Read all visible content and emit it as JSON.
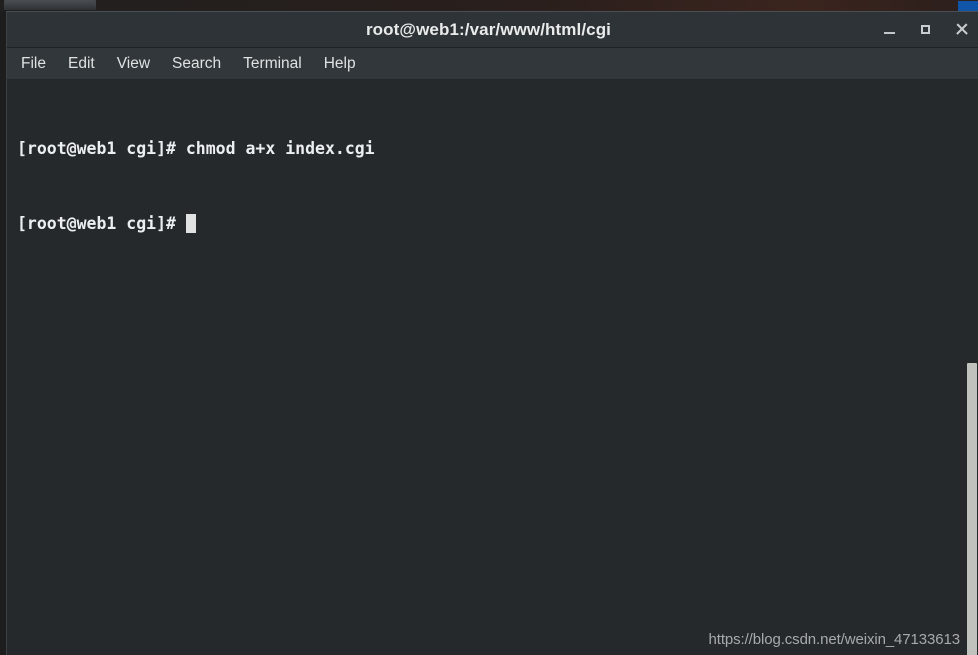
{
  "desktop": {
    "taskbar_button_label": "",
    "accent_blue": "#1155a8"
  },
  "window": {
    "title": "root@web1:/var/www/html/cgi",
    "background_color": "#26292c",
    "titlebar_color": "#2e3337",
    "controls": {
      "minimize_label": "_",
      "maximize_label": "□",
      "close_label": "×"
    }
  },
  "menubar": {
    "items": [
      {
        "label": "File"
      },
      {
        "label": "Edit"
      },
      {
        "label": "View"
      },
      {
        "label": "Search"
      },
      {
        "label": "Terminal"
      },
      {
        "label": "Help"
      }
    ]
  },
  "terminal": {
    "foreground_color": "#eceff1",
    "cursor_color": "#dfe2e0",
    "lines": [
      {
        "text": "[root@web1 cgi]# chmod a+x index.cgi",
        "has_cursor": false
      },
      {
        "text": "[root@web1 cgi]# ",
        "has_cursor": true
      }
    ]
  },
  "scrollbar": {
    "thumb_color": "#c1c2bd",
    "position_percent": 49
  },
  "watermark": {
    "text": "https://blog.csdn.net/weixin_47133613"
  }
}
